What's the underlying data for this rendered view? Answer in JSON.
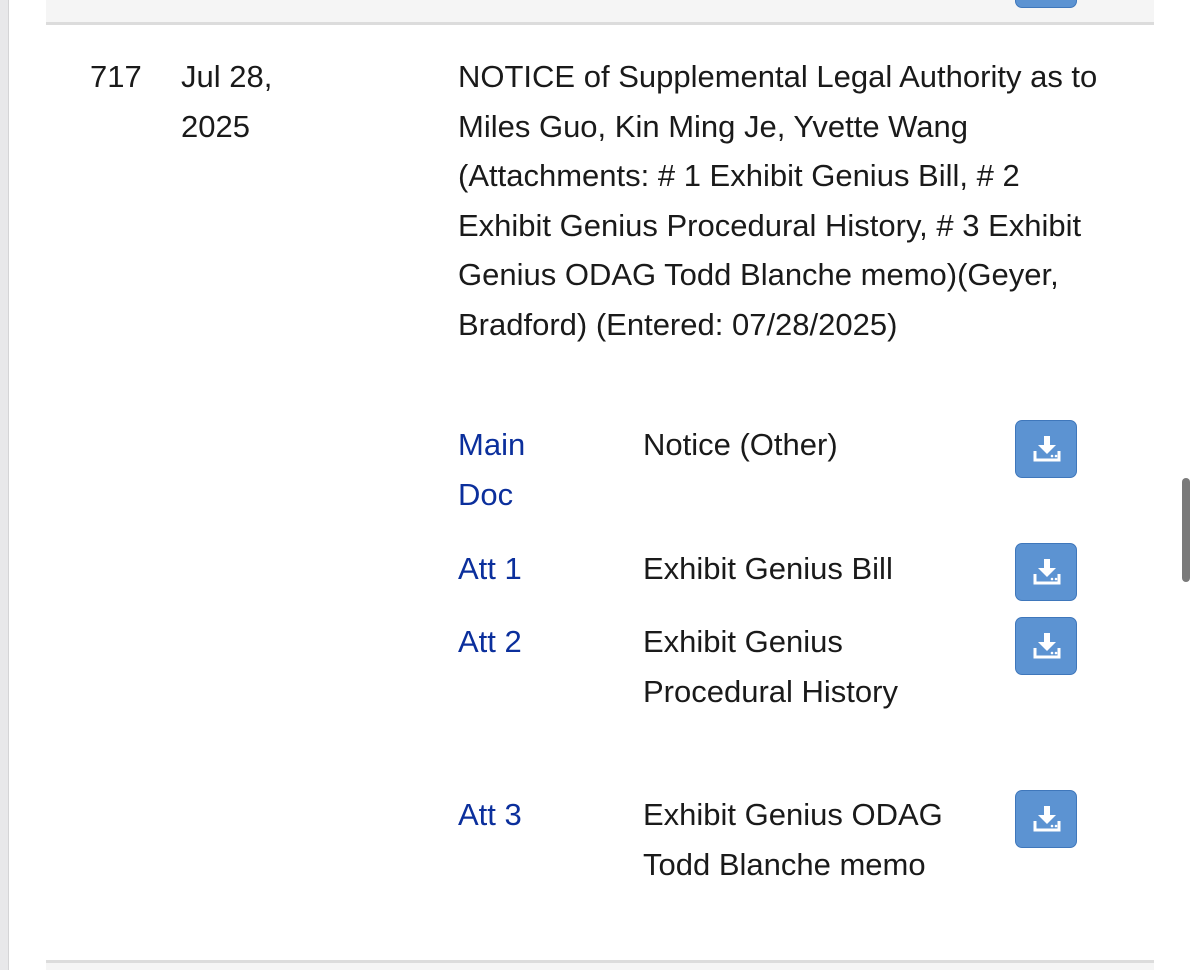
{
  "entry": {
    "number": "717",
    "date": "Jul 28, 2025",
    "description": "NOTICE of Supplemental Legal Authority as to Miles Guo, Kin Ming Je, Yvette Wang (Attachments: # 1 Exhibit Genius Bill, # 2 Exhibit Genius Procedural History, # 3 Exhibit Genius ODAG Todd Blanche memo)(Geyer, Bradford) (Entered: 07/28/2025)"
  },
  "documents": [
    {
      "link": "Main Doc",
      "description": "Notice (Other)",
      "icon": "download-icon"
    },
    {
      "link": "Att 1",
      "description": "Exhibit Genius Bill",
      "icon": "download-icon"
    },
    {
      "link": "Att 2",
      "description": "Exhibit Genius Procedural History",
      "icon": "download-icon"
    },
    {
      "link": "Att 3",
      "description": "Exhibit Genius ODAG Todd Blanche memo",
      "icon": "download-icon"
    }
  ],
  "colors": {
    "link": "#0b2f9c",
    "button": "#5c93d2",
    "text": "#1a1a1a",
    "separator": "#dcdcdc"
  }
}
